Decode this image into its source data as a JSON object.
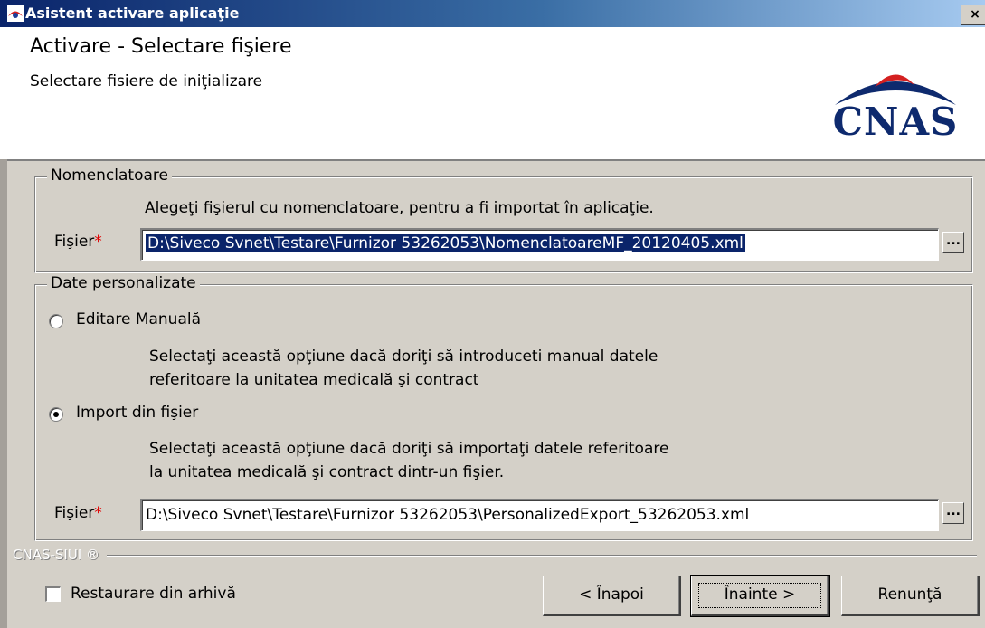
{
  "window": {
    "title": "Asistent activare aplicaţie",
    "close_label": "×"
  },
  "header": {
    "title": "Activare - Selectare fişiere",
    "subtitle": "Selectare fisiere de iniţializare",
    "logo_text": "CNAS"
  },
  "nomenclatoare": {
    "legend": "Nomenclatoare",
    "description": "Alegeţi fişierul cu nomenclatoare, pentru a fi importat în aplicaţie.",
    "field_label": "Fişier",
    "required_mark": "*",
    "value": "D:\\Siveco Svnet\\Testare\\Furnizor 53262053\\NomenclatoareMF_20120405.xml",
    "browse_label": "..."
  },
  "date_personalizate": {
    "legend": "Date personalizate",
    "option_manual": {
      "label": "Editare Manuală",
      "selected": false,
      "description_line1": "Selectaţi această opţiune dacă doriţi să introduceti manual datele",
      "description_line2": "referitoare la unitatea medicală şi contract"
    },
    "option_import": {
      "label": "Import din fişier",
      "selected": true,
      "description_line1": "Selectaţi această opţiune dacă doriţi să importaţi datele referitoare",
      "description_line2": "la unitatea medicală şi contract dintr-un fişier."
    },
    "field_label": "Fişier",
    "required_mark": "*",
    "value": "D:\\Siveco Svnet\\Testare\\Furnizor 53262053\\PersonalizedExport_53262053.xml",
    "browse_label": "..."
  },
  "footer": {
    "brand": "CNAS-SIUI ®",
    "restore_label": "Restaurare din arhivă",
    "restore_checked": false,
    "back_label": "< Înapoi",
    "next_label": "Înainte >",
    "cancel_label": "Renunţă"
  },
  "colors": {
    "title_bar": "#0a246a",
    "selection": "#0a246a",
    "required": "#e00000",
    "logo": "#0e2a6e"
  },
  "icons": {
    "app_icon": "cnas-app-icon",
    "logo_roof": "cnas-roof-logo"
  }
}
